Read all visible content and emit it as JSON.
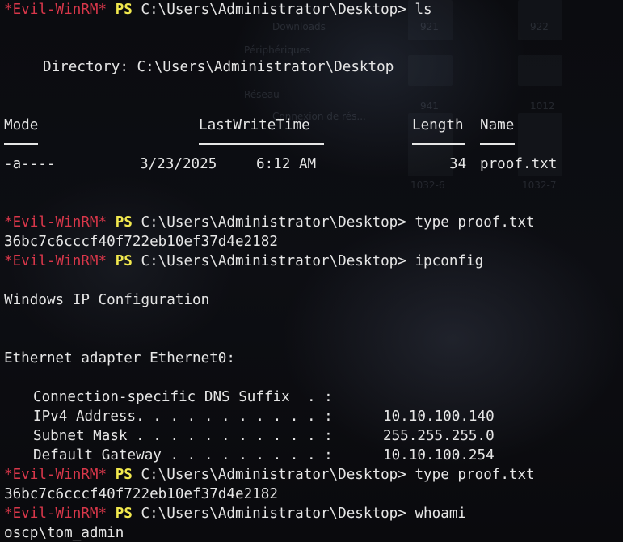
{
  "background_ghost": {
    "items": [
      "Downloads",
      "Périphériques",
      "Réseau",
      "Connexion de rés..."
    ],
    "numbers": [
      "921",
      "922",
      "941",
      "1012",
      "1032-6",
      "1032-7"
    ]
  },
  "terminal": {
    "prompt": {
      "host": "*Evil-WinRM*",
      "ps": "PS",
      "path": "C:\\Users\\Administrator\\Desktop>"
    },
    "commands": {
      "ls": "ls",
      "type1": "type proof.txt",
      "ipconfig": "ipconfig",
      "type2": "type proof.txt",
      "whoami": "whoami"
    },
    "directory_line": "Directory: C:\\Users\\Administrator\\Desktop",
    "listing": {
      "headers": {
        "mode": "Mode",
        "lastwritetime": "LastWriteTime",
        "length": "Length",
        "name": "Name"
      },
      "row": {
        "mode": "-a----",
        "date": "3/23/2025",
        "time": "6:12 AM",
        "length": "34",
        "name": "proof.txt"
      }
    },
    "proof_hash_1": "36bc7c6cccf40f722eb10ef37d4e2182",
    "ipconfig": {
      "title": "Windows IP Configuration",
      "adapter": "Ethernet adapter Ethernet0:",
      "dns_label": "Connection-specific DNS Suffix  . :",
      "ipv4_label": "IPv4 Address. . . . . . . . . . . :",
      "ipv4_value": "10.10.100.140",
      "mask_label": "Subnet Mask . . . . . . . . . . . :",
      "mask_value": "255.255.255.0",
      "gw_label": "Default Gateway . . . . . . . . . :",
      "gw_value": "10.10.100.254"
    },
    "proof_hash_2": "36bc7c6cccf40f722eb10ef37d4e2182",
    "whoami_output": "oscp\\tom_admin"
  },
  "colors": {
    "host": "#d9374a",
    "ps": "#f2e94e",
    "text": "#e6e6e6",
    "background": "#0a0a0d"
  }
}
